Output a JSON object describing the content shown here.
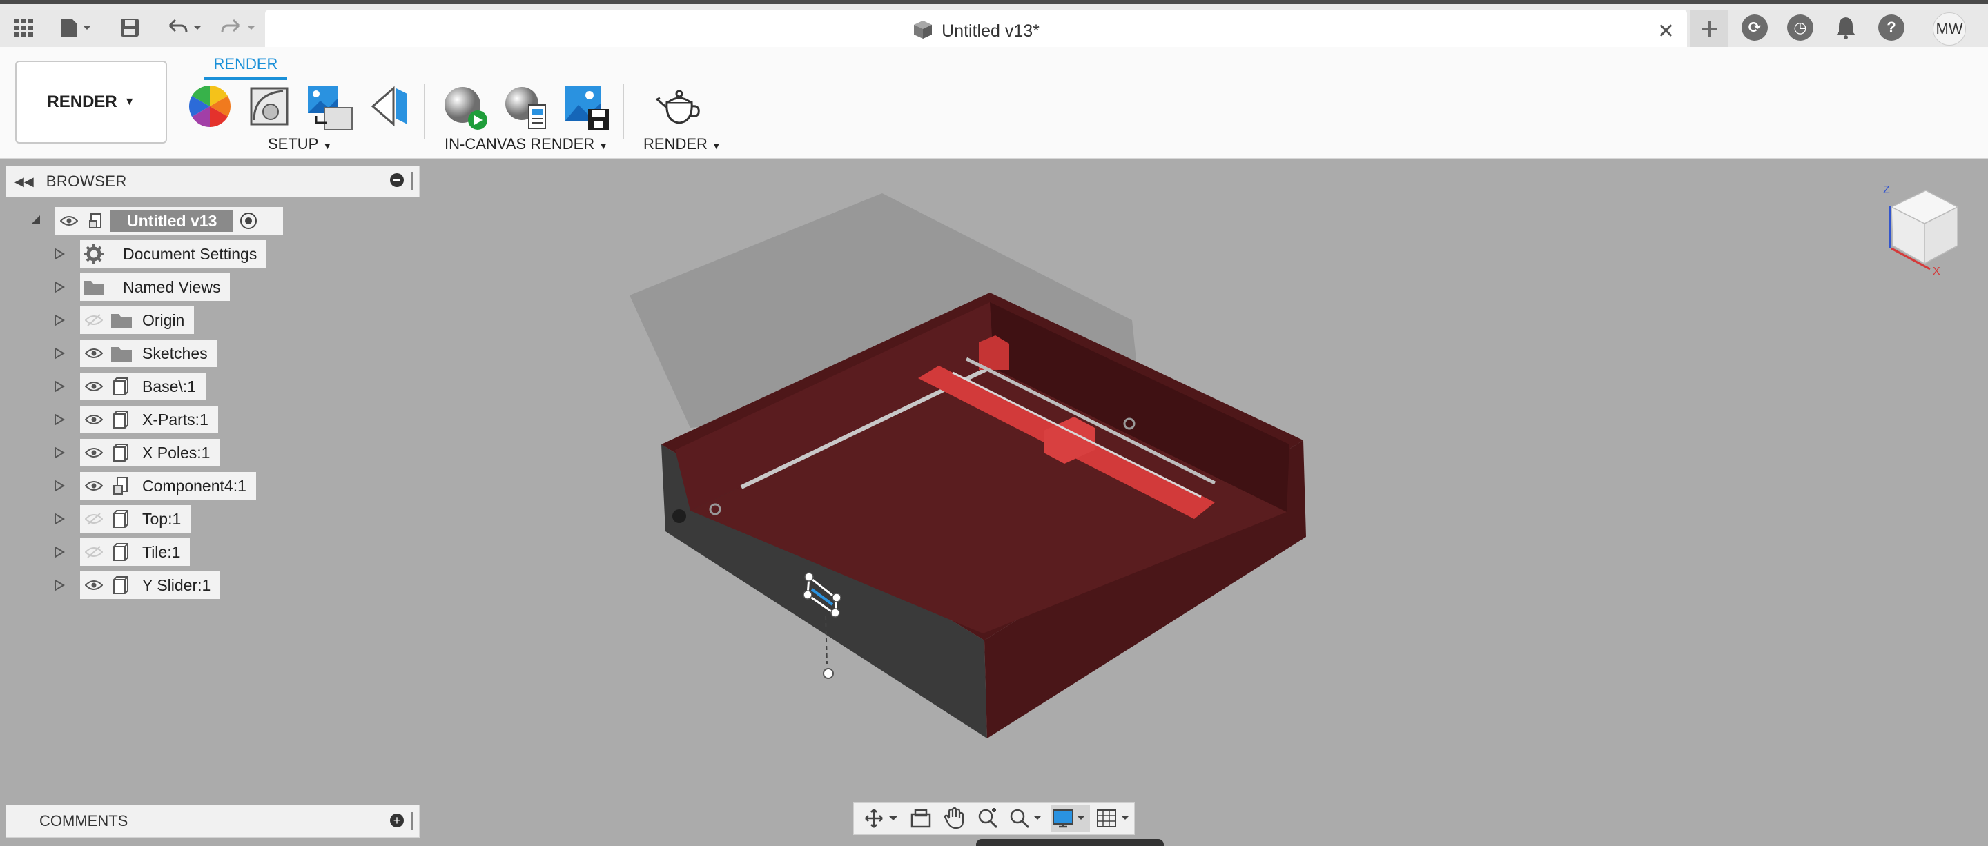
{
  "titlebar": {
    "document_title": "Untitled v13*",
    "avatar_initials": "MW"
  },
  "ribbon": {
    "workspace_label": "RENDER",
    "active_tab": "RENDER",
    "groups": {
      "setup": "SETUP",
      "in_canvas": "IN-CANVAS RENDER",
      "render": "RENDER"
    }
  },
  "browser": {
    "header": "BROWSER",
    "root": "Untitled v13",
    "items": [
      {
        "label": "Document Settings",
        "icon": "gear-icon",
        "visibility": "none"
      },
      {
        "label": "Named Views",
        "icon": "folder-icon",
        "visibility": "none"
      },
      {
        "label": "Origin",
        "icon": "folder-icon",
        "visibility": "hidden"
      },
      {
        "label": "Sketches",
        "icon": "folder-icon",
        "visibility": "visible"
      },
      {
        "label": "Base\\:1",
        "icon": "body-icon",
        "visibility": "visible"
      },
      {
        "label": "X-Parts:1",
        "icon": "body-icon",
        "visibility": "visible"
      },
      {
        "label": "X Poles:1",
        "icon": "body-icon",
        "visibility": "visible"
      },
      {
        "label": "Component4:1",
        "icon": "component-icon",
        "visibility": "visible"
      },
      {
        "label": "Top:1",
        "icon": "body-icon",
        "visibility": "hidden"
      },
      {
        "label": "Tile:1",
        "icon": "body-icon",
        "visibility": "hidden"
      },
      {
        "label": "Y Slider:1",
        "icon": "body-icon",
        "visibility": "visible"
      }
    ]
  },
  "comments": {
    "header": "COMMENTS"
  },
  "colors": {
    "accent": "#1a90d8",
    "canvas": "#ababab",
    "wood": "#5a1a1c",
    "red_parts": "#d63b3b"
  }
}
